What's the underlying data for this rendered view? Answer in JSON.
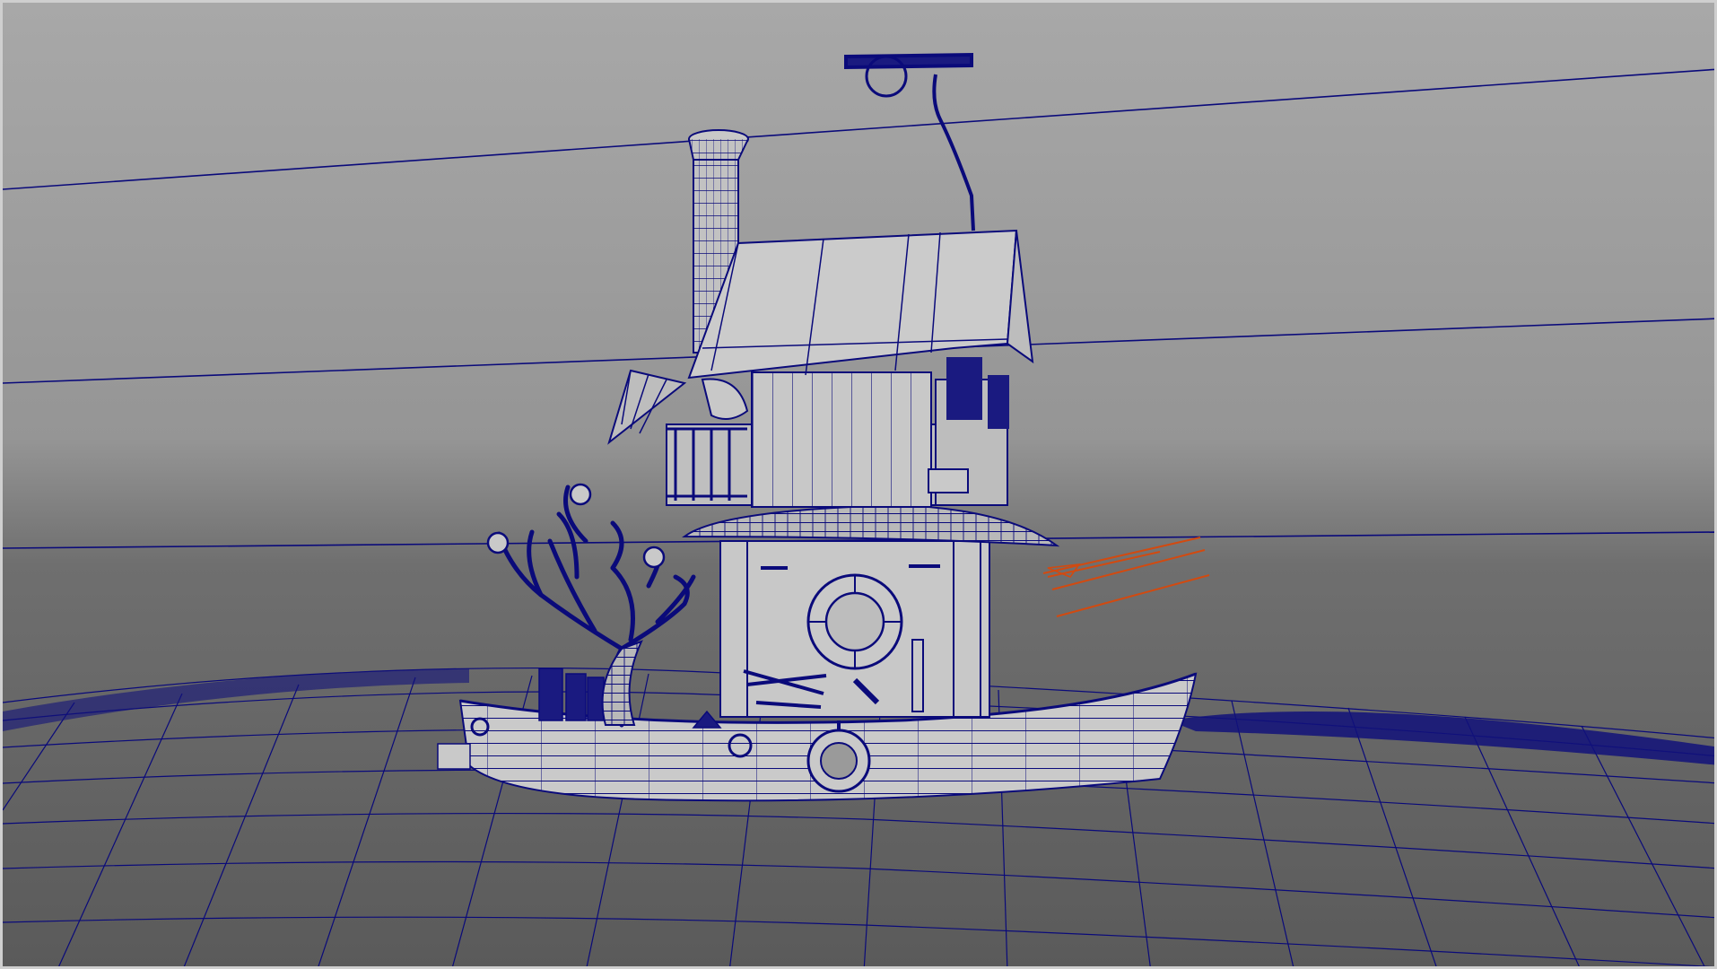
{
  "viewport": {
    "background_top": "#a6a6a6",
    "background_mid": "#8e8e8e",
    "background_bottom": "#5c5c5c",
    "frame_color": "#cfcfcf"
  },
  "wireframe": {
    "line_color": "#0a0a7a",
    "fill_color": "#c9c9c9",
    "water_color": "#12127a",
    "selection_color": "#d24a10"
  },
  "scene": {
    "subject": "boat-house",
    "shading_mode": "wireframe-on-shaded"
  }
}
